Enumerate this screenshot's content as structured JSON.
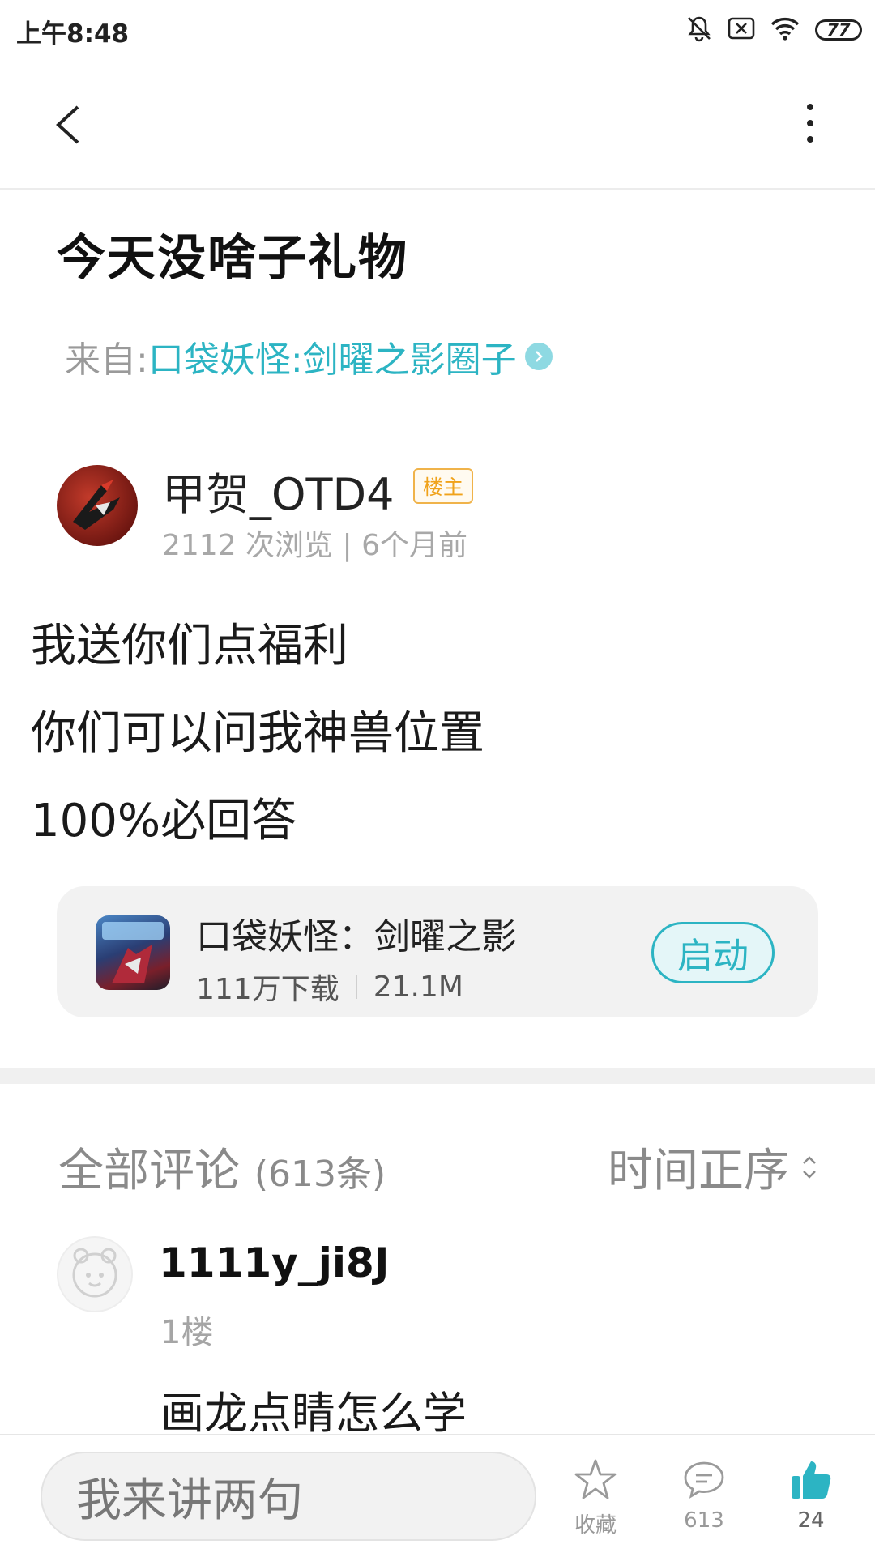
{
  "status_bar": {
    "time": "上午8:48",
    "battery": "77",
    "icons": [
      "bell-off-icon",
      "sim-cross-icon",
      "wifi-icon",
      "battery-icon"
    ]
  },
  "header": {
    "back_icon": "chevron-left-icon",
    "more_icon": "more-vertical-icon"
  },
  "post": {
    "title": "今天没啥子礼物",
    "from_label": "来自:",
    "from_circle": "口袋妖怪:剑曜之影圈子",
    "author": {
      "name": "甲贺_OTD4",
      "badge": "楼主",
      "meta": "2112 次浏览 | 6个月前"
    },
    "body_lines": [
      "我送你们点福利",
      "你们可以问我神兽位置",
      "100%必回答"
    ]
  },
  "game_card": {
    "name": "口袋妖怪：剑曜之影",
    "downloads": "111万下载",
    "size": "21.1M",
    "launch_label": "启动"
  },
  "comments": {
    "title": "全部评论",
    "count": "(613条)",
    "sort_label": "时间正序",
    "first": {
      "user": "1111y_ji8J",
      "floor": "1楼",
      "text": "画龙点睛怎么学"
    }
  },
  "bottom_bar": {
    "input_placeholder": "我来讲两句",
    "favorite_label": "收藏",
    "comment_count": "613",
    "like_count": "24",
    "accent_color": "#2cb4c3"
  }
}
